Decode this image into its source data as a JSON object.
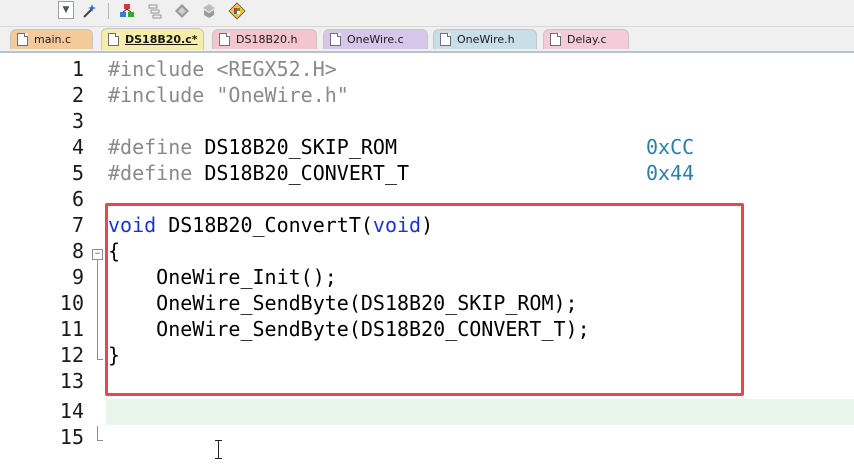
{
  "toolbar": {
    "icons": [
      "dropdown-arrow-icon",
      "magic-wand-icon",
      "stack-icon",
      "layers-icon",
      "diamond-icon",
      "bucket-icon",
      "color-grid-icon"
    ]
  },
  "tabs": [
    {
      "label": "main.c",
      "color": "#f5ca9a",
      "active": false
    },
    {
      "label": "DS18B20.c*",
      "color": "#f6eda8",
      "active": true
    },
    {
      "label": "DS18B20.h",
      "color": "#f4c4cf",
      "active": false
    },
    {
      "label": "OneWire.c",
      "color": "#d6c6ea",
      "active": false
    },
    {
      "label": "OneWire.h",
      "color": "#c8dfe9",
      "active": false
    },
    {
      "label": "Delay.c",
      "color": "#f3cbd9",
      "active": false
    }
  ],
  "editor": {
    "highlighted_line": "14",
    "lines": [
      {
        "num": "1",
        "t1": "#include <REGX52.H>"
      },
      {
        "num": "2",
        "t1": "#include \"OneWire.h\""
      },
      {
        "num": "3"
      },
      {
        "num": "4",
        "t1": "#define",
        "t2": " DS18B20_SKIP_ROM",
        "t3": "0xCC"
      },
      {
        "num": "5",
        "t1": "#define",
        "t2": " DS18B20_CONVERT_T",
        "t3": "0x44"
      },
      {
        "num": "6"
      },
      {
        "num": "7",
        "t1": "void",
        "t2": " DS18B20_ConvertT(",
        "t3": "void",
        "t4": ")"
      },
      {
        "num": "8",
        "t1": "{"
      },
      {
        "num": "9",
        "t1": "    OneWire_Init();"
      },
      {
        "num": "10",
        "t1": "    OneWire_SendByte(DS18B20_SKIP_ROM);"
      },
      {
        "num": "11",
        "t1": "    OneWire_SendByte(DS18B20_CONVERT_T);"
      },
      {
        "num": "12",
        "t1": "}"
      },
      {
        "num": "13"
      },
      {
        "num": "14"
      },
      {
        "num": "15"
      }
    ]
  },
  "colors": {
    "keyword": "#1a36d1",
    "preprocessor": "#8a8a8a",
    "number": "#2d7fa5",
    "selection_box": "#e5484d",
    "current_line": "#e8f6ec"
  }
}
